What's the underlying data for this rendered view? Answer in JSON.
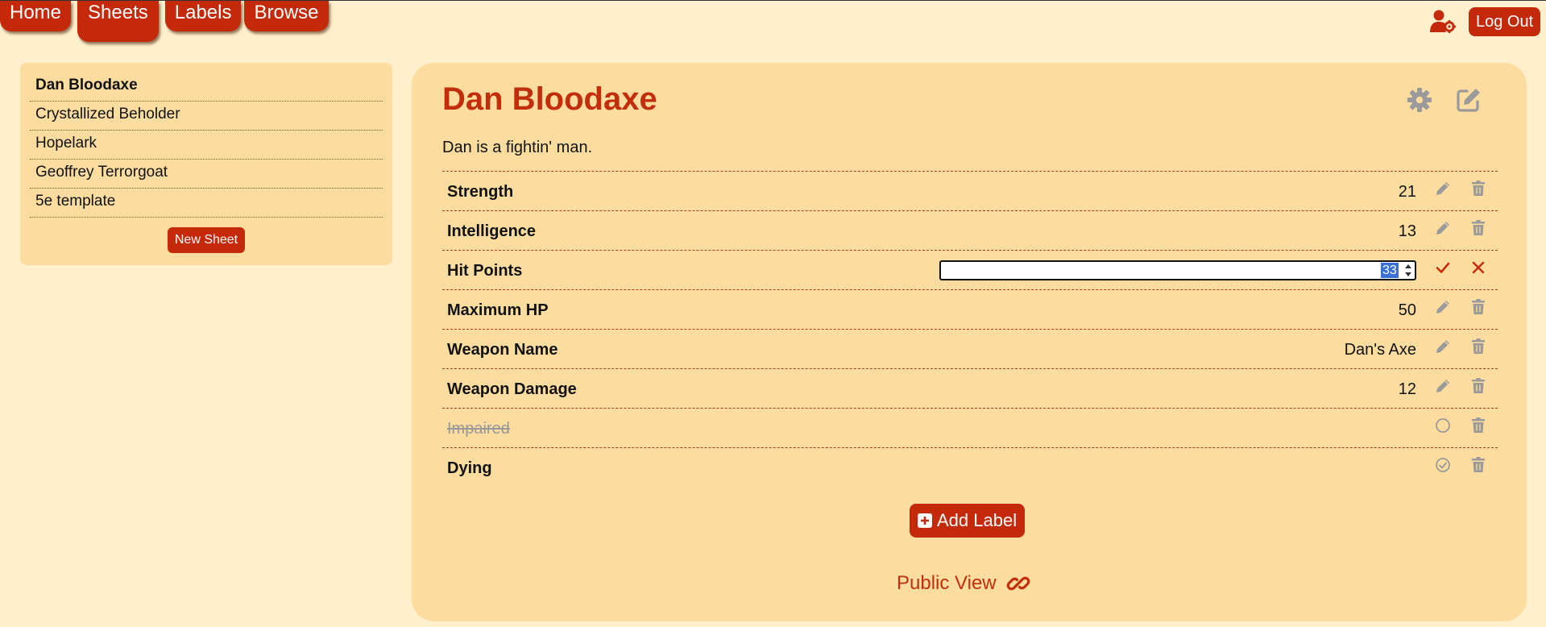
{
  "nav": {
    "tabs": [
      {
        "label": "Home"
      },
      {
        "label": "Sheets"
      },
      {
        "label": "Labels"
      },
      {
        "label": "Browse"
      }
    ],
    "active_tab": "Sheets",
    "logout_label": "Log Out",
    "user_icon": "user-gear-icon"
  },
  "sidebar": {
    "items": [
      {
        "label": "Dan Bloodaxe",
        "active": true
      },
      {
        "label": "Crystallized Beholder"
      },
      {
        "label": "Hopelark"
      },
      {
        "label": "Geoffrey Terrorgoat"
      },
      {
        "label": "5e template"
      }
    ],
    "new_sheet_label": "New Sheet"
  },
  "sheet": {
    "title": "Dan Bloodaxe",
    "description": "Dan is a fightin' man.",
    "header_icons": [
      "gear-icon",
      "edit-icon"
    ],
    "labels": [
      {
        "name": "Strength",
        "value": "21"
      },
      {
        "name": "Intelligence",
        "value": "13"
      },
      {
        "name": "Hit Points",
        "value": "33",
        "editing": true
      },
      {
        "name": "Maximum HP",
        "value": "50"
      },
      {
        "name": "Weapon Name",
        "value": "Dan's Axe"
      },
      {
        "name": "Weapon Damage",
        "value": "12"
      },
      {
        "name": "Impaired",
        "boolean": true,
        "checked": false
      },
      {
        "name": "Dying",
        "boolean": true,
        "checked": true
      }
    ],
    "add_label": "Add Label",
    "public_view": "Public View"
  },
  "colors": {
    "accent": "#c42a0a",
    "page_background": "#ffefcc",
    "panel_background": "#fddd9f",
    "title": "#c22e0c",
    "icon_gray": "#9a9a9a"
  }
}
